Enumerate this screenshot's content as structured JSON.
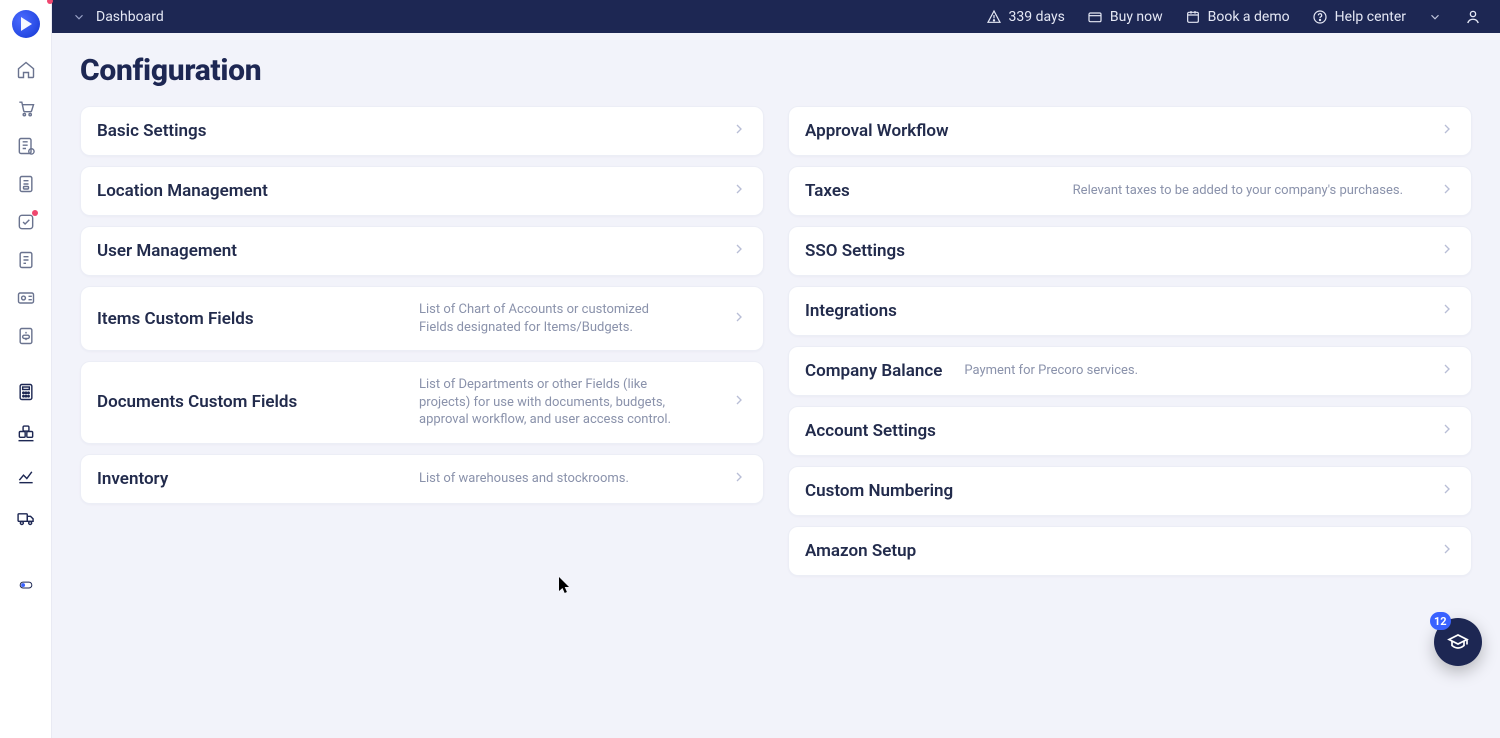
{
  "topbar": {
    "breadcrumb": "Dashboard",
    "trial_days": "339 days",
    "buy_now": "Buy now",
    "book_demo": "Book a demo",
    "help_center": "Help center"
  },
  "page": {
    "title": "Configuration"
  },
  "left_cards": [
    {
      "title": "Basic Settings",
      "desc": ""
    },
    {
      "title": "Location Management",
      "desc": ""
    },
    {
      "title": "User Management",
      "desc": ""
    },
    {
      "title": "Items Custom Fields",
      "desc": "List of Chart of Accounts or customized Fields designated for Items/Budgets."
    },
    {
      "title": "Documents Custom Fields",
      "desc": "List of Departments or other Fields (like projects) for use with documents, budgets, approval workflow, and user access control."
    },
    {
      "title": "Inventory",
      "desc": "List of warehouses and stockrooms."
    }
  ],
  "right_cards": [
    {
      "title": "Approval Workflow",
      "desc": ""
    },
    {
      "title": "Taxes",
      "desc": "Relevant taxes to be added to your company's purchases."
    },
    {
      "title": "SSO Settings",
      "desc": ""
    },
    {
      "title": "Integrations",
      "desc": ""
    },
    {
      "title": "Company Balance",
      "desc": "Payment for Precoro services."
    },
    {
      "title": "Account Settings",
      "desc": ""
    },
    {
      "title": "Custom Numbering",
      "desc": ""
    },
    {
      "title": "Amazon Setup",
      "desc": ""
    }
  ],
  "help_bubble": {
    "badge": "12"
  }
}
